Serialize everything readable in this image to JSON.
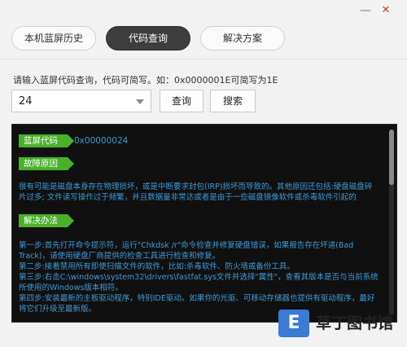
{
  "window": {
    "minimize_icon": "minimize-icon",
    "close_icon": "close-icon",
    "accent_close": "#e0342e"
  },
  "tabs": {
    "history": "本机蓝屏历史",
    "query": "代码查询",
    "solution": "解决方案",
    "active": "query"
  },
  "query": {
    "hint": "请输入蓝屏代码查询，代码可简写。如：0x0000001E可简写为1E",
    "select_value": "24",
    "query_button": "查询",
    "search_button": "搜索"
  },
  "result": {
    "code_label": "蓝屏代码",
    "code_value": "0x00000024",
    "cause_label": "故障原因",
    "cause_lines": [
      "很有可能是磁盘本身存在物理损坏，或是中断要求封包(IRP)损坏而导致的。其他原因还包括:硬盘磁盘碎",
      "片过多; 文件读写操作过于频繁，并且数据量非常达或者是由于一些磁盘镜像软件或杀毒软件引起的"
    ],
    "solution_label": "解决办法",
    "solution_lines": [
      "第一步:首先打开命令提示符，运行\"Chkdsk /r\"命令检查并修复硬盘错误，如果报告存在坏道(Bad",
      "Track)，请使用硬盘厂商提供的检查工具进行检查和修复。",
      "第二步:接着禁用所有即使扫描文件的软件，比如:杀毒软件、防火墙或备份工具。",
      "第三步:右击C:\\windows\\system32\\drivers\\fastfat.sys文件并选择\"属性\"，查看其版本是否与当前系统",
      "所使用的Windows版本相符。",
      "第四步:安装最新的主板驱动程序，特别IDE驱动。如果你的光驱、可移动存储器也提供有驱动程序，最好",
      "将它们升级至最新版。",
      ""
    ],
    "badge_color": "#49b02a",
    "text_color": "#3f9bd6"
  },
  "watermark": {
    "logo_letter": "E",
    "text": "草丁图书馆"
  }
}
